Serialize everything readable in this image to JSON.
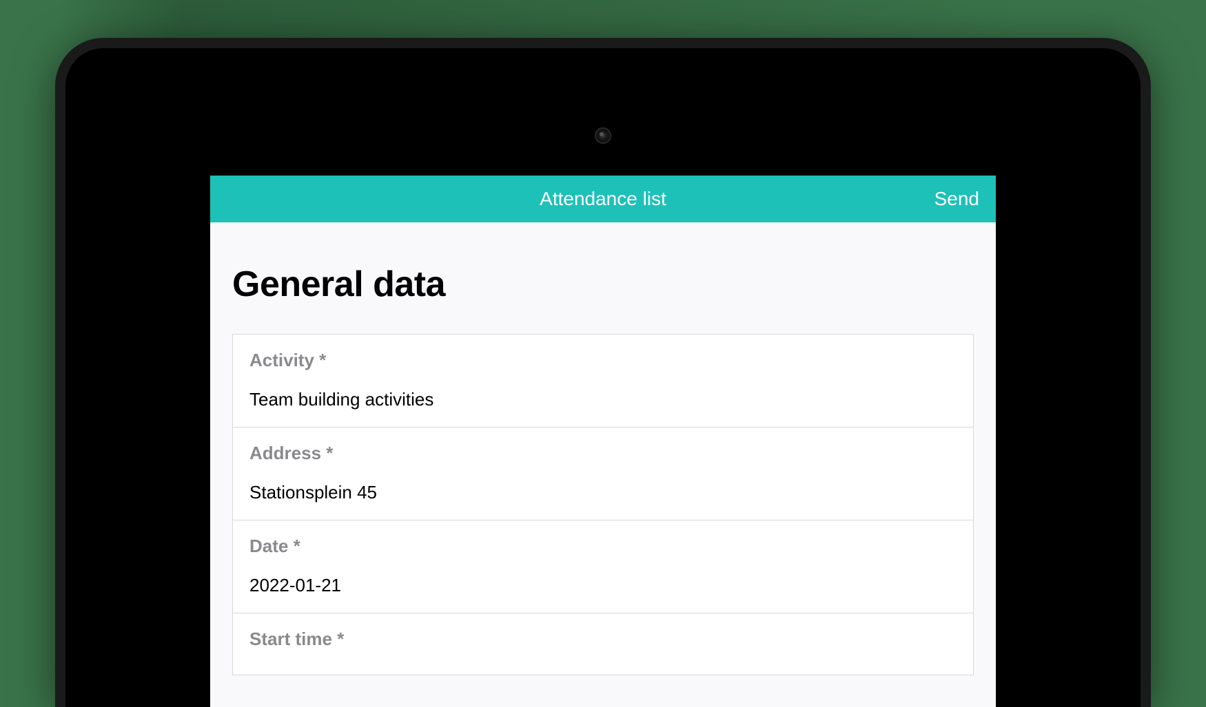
{
  "header": {
    "title": "Attendance list",
    "send_label": "Send"
  },
  "section": {
    "title": "General data"
  },
  "fields": [
    {
      "label": "Activity *",
      "value": "Team building activities"
    },
    {
      "label": "Address *",
      "value": "Stationsplein 45"
    },
    {
      "label": "Date *",
      "value": "2022-01-21"
    },
    {
      "label": "Start time *",
      "value": ""
    }
  ],
  "colors": {
    "accent": "#1dc1b8",
    "background": "#f9f9fb",
    "label": "#8a8a8e"
  }
}
